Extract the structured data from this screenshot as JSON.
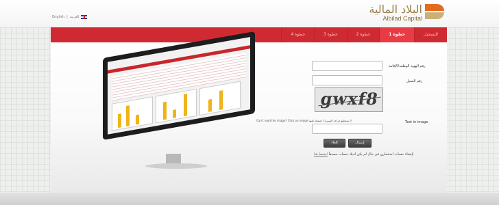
{
  "header": {
    "language": {
      "english": "English",
      "separator": "|",
      "arabic": "العربية"
    },
    "logo": {
      "arabic": "البلاد المالية",
      "english": "Albilad Capital"
    }
  },
  "nav": {
    "items": [
      {
        "label": "التسجيل"
      },
      {
        "label": "خطوة 1"
      },
      {
        "label": "خطوة 2"
      },
      {
        "label": "خطوة 3"
      },
      {
        "label": "خطوة 4"
      }
    ],
    "active_index": 1
  },
  "form": {
    "id_label": "رقم الهوية الوطنية/الإقامة",
    "id_value": "",
    "client_label": "رقم العميل",
    "client_value": "",
    "captcha_text": "gwxf8",
    "text_in_image_label": "Text in image",
    "captcha_hint": "Can't read the image? Click on image لا تستطيع قراءة الصورة؟ اضغط عليها",
    "captcha_value": "",
    "send_button": "إرسال",
    "cancel_button": "إلغاء",
    "note_text": "لإنشاء حساب استثماري في حال لم يكن لديك حساب مسبقاً",
    "note_link": "اضغط هنا"
  },
  "colors": {
    "nav_red": "#cf2a32",
    "nav_active": "#e83b43",
    "logo_gold": "#9a7d4a",
    "logo_orange": "#e36b1f"
  }
}
